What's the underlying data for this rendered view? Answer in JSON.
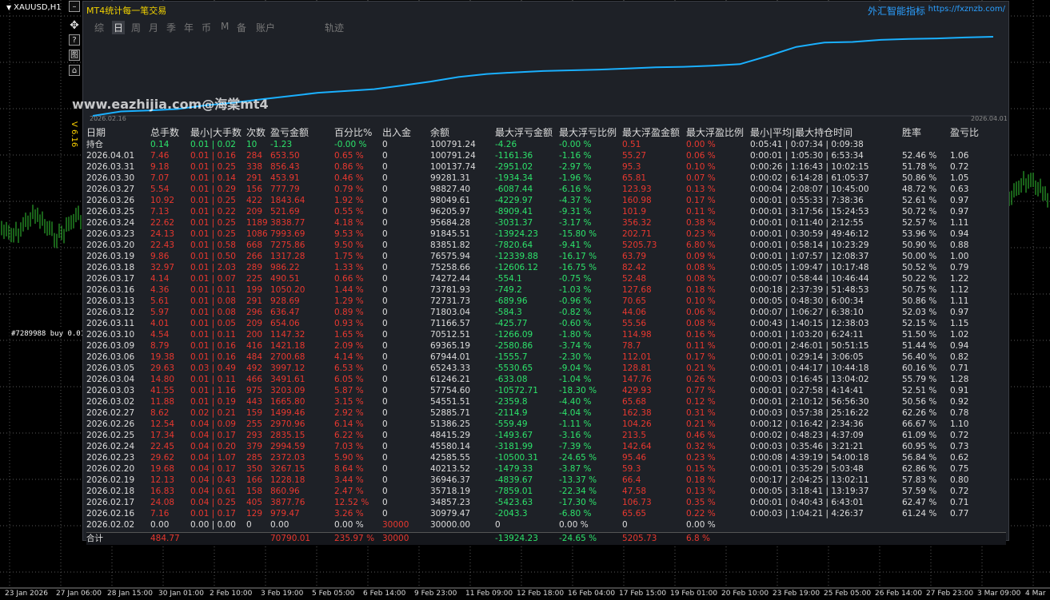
{
  "symbol": "XAUUSD,H1",
  "side_buttons": [
    "–",
    "✥",
    "?",
    "图",
    "⌂"
  ],
  "x_axis_labels": [
    "23 Jan 2026",
    "27 Jan 06:00",
    "28 Jan 15:00",
    "30 Jan 01:00",
    "2 Feb 10:00",
    "3 Feb 19:00",
    "5 Feb 05:00",
    "6 Feb 14:00",
    "9 Feb 23:00",
    "11 Feb 09:00",
    "12 Feb 18:00",
    "16 Feb 04:00",
    "17 Feb 15:00",
    "19 Feb 01:00",
    "20 Feb 10:00",
    "23 Feb 19:00",
    "25 Feb 05:00",
    "26 Feb 14:00",
    "27 Feb 23:00",
    "3 Mar 09:00",
    "4 Mar"
  ],
  "panel": {
    "title": "MT4统计每一笔交易",
    "brand": "外汇智能指标",
    "url": "https://fxznzb.com/",
    "tabs": [
      "综",
      "日",
      "周",
      "月",
      "季",
      "年",
      "币",
      "M",
      "备",
      "账户",
      "轨迹"
    ],
    "active_tab": "日",
    "watermark": "www.eazhijia.com@海棠mt4",
    "version": "V 6.16",
    "equity_start_label": "2026.02.16",
    "equity_end_label": "2026.04.01",
    "accent_color": "#1ab0ff",
    "equity_values": [
      30979.47,
      34857.23,
      35718.19,
      36946.37,
      40213.52,
      42585.55,
      45580.14,
      48415.29,
      51386.25,
      52885.71,
      54551.51,
      57754.6,
      61246.21,
      65243.33,
      67944.01,
      69365.19,
      70512.51,
      71166.57,
      71803.04,
      72731.73,
      73781.93,
      74272.44,
      75258.66,
      76575.94,
      83851.82,
      91845.51,
      95684.28,
      96205.97,
      98049.61,
      98827.4,
      99281.31,
      100137.74,
      100791.24
    ]
  },
  "headers": [
    "日期",
    "总手数",
    "最小|大手数",
    "次数",
    "盈亏金额",
    "百分比%",
    "出入金",
    "余额",
    "最大浮亏金额",
    "最大浮亏比例",
    "最大浮盈金额",
    "最大浮盈比例",
    "最小|平均|最大持仓时间",
    "胜率",
    "盈亏比"
  ],
  "holding": [
    "持仓",
    "0.14",
    "0.01 | 0.02",
    "10",
    "-1.23",
    "-0.00 %",
    "0",
    "100791.24",
    "-4.26",
    "-0.00 %",
    "0.51",
    "0.00 %",
    "0:05:41 | 0:07:34 | 0:09:38",
    "",
    ""
  ],
  "rows": [
    [
      "2026.04.01",
      "7.46",
      "0.01 | 0.16",
      "284",
      "653.50",
      "0.65 %",
      "0",
      "100791.24",
      "-1161.36",
      "-1.16 %",
      "55.27",
      "0.06 %",
      "0:00:01 | 1:05:30 | 6:53:34",
      "52.46 %",
      "1.06"
    ],
    [
      "2026.03.31",
      "9.18",
      "0.01 | 0.25",
      "338",
      "856.43",
      "0.86 %",
      "0",
      "100137.74",
      "-2951.02",
      "-2.97 %",
      "95.3",
      "0.10 %",
      "0:00:26 | 1:16:43 | 10:02:15",
      "51.78 %",
      "0.72"
    ],
    [
      "2026.03.30",
      "7.07",
      "0.01 | 0.14",
      "291",
      "453.91",
      "0.46 %",
      "0",
      "99281.31",
      "-1934.34",
      "-1.96 %",
      "65.81",
      "0.07 %",
      "0:00:02 | 6:14:28 | 61:05:37",
      "50.86 %",
      "1.05"
    ],
    [
      "2026.03.27",
      "5.54",
      "0.01 | 0.29",
      "156",
      "777.79",
      "0.79 %",
      "0",
      "98827.40",
      "-6087.44",
      "-6.16 %",
      "123.93",
      "0.13 %",
      "0:00:04 | 2:08:07 | 10:45:00",
      "48.72 %",
      "0.63"
    ],
    [
      "2026.03.26",
      "10.92",
      "0.01 | 0.25",
      "422",
      "1843.64",
      "1.92 %",
      "0",
      "98049.61",
      "-4229.97",
      "-4.37 %",
      "160.98",
      "0.17 %",
      "0:00:01 | 0:55:33 | 7:38:36",
      "52.61 %",
      "0.97"
    ],
    [
      "2026.03.25",
      "7.13",
      "0.01 | 0.22",
      "209",
      "521.69",
      "0.55 %",
      "0",
      "96205.97",
      "-8909.41",
      "-9.31 %",
      "101.9",
      "0.11 %",
      "0:00:01 | 3:17:56 | 15:24:53",
      "50.72 %",
      "0.97"
    ],
    [
      "2026.03.24",
      "22.62",
      "0.01 | 0.25",
      "1189",
      "3838.77",
      "4.18 %",
      "0",
      "95684.28",
      "-3031.37",
      "-3.17 %",
      "356.32",
      "0.38 %",
      "0:00:01 | 0:11:40 | 2:12:55",
      "52.57 %",
      "1.11"
    ],
    [
      "2026.03.23",
      "24.13",
      "0.01 | 0.25",
      "1086",
      "7993.69",
      "9.53 %",
      "0",
      "91845.51",
      "-13924.23",
      "-15.80 %",
      "202.71",
      "0.23 %",
      "0:00:01 | 0:30:59 | 49:46:12",
      "53.96 %",
      "0.94"
    ],
    [
      "2026.03.20",
      "22.43",
      "0.01 | 0.58",
      "668",
      "7275.86",
      "9.50 %",
      "0",
      "83851.82",
      "-7820.64",
      "-9.41 %",
      "5205.73",
      "6.80 %",
      "0:00:01 | 0:58:14 | 10:23:29",
      "50.90 %",
      "0.88"
    ],
    [
      "2026.03.19",
      "9.86",
      "0.01 | 0.50",
      "266",
      "1317.28",
      "1.75 %",
      "0",
      "76575.94",
      "-12339.88",
      "-16.17 %",
      "63.79",
      "0.09 %",
      "0:00:01 | 1:07:57 | 12:08:37",
      "50.00 %",
      "1.00"
    ],
    [
      "2026.03.18",
      "32.97",
      "0.01 | 2.03",
      "289",
      "986.22",
      "1.33 %",
      "0",
      "75258.66",
      "-12606.12",
      "-16.75 %",
      "82.42",
      "0.08 %",
      "0:00:05 | 1:09:47 | 10:17:48",
      "50.52 %",
      "0.79"
    ],
    [
      "2026.03.17",
      "4.14",
      "0.01 | 0.07",
      "225",
      "490.51",
      "0.66 %",
      "0",
      "74272.44",
      "-554.1",
      "-0.75 %",
      "52.48",
      "0.08 %",
      "0:00:07 | 0:58:44 | 10:46:44",
      "50.22 %",
      "1.22"
    ],
    [
      "2026.03.16",
      "4.36",
      "0.01 | 0.11",
      "199",
      "1050.20",
      "1.44 %",
      "0",
      "73781.93",
      "-749.2",
      "-1.03 %",
      "127.68",
      "0.18 %",
      "0:00:18 | 2:37:39 | 51:48:53",
      "50.75 %",
      "1.12"
    ],
    [
      "2026.03.13",
      "5.61",
      "0.01 | 0.08",
      "291",
      "928.69",
      "1.29 %",
      "0",
      "72731.73",
      "-689.96",
      "-0.96 %",
      "70.65",
      "0.10 %",
      "0:00:05 | 0:48:30 | 6:00:34",
      "50.86 %",
      "1.11"
    ],
    [
      "2026.03.12",
      "5.97",
      "0.01 | 0.08",
      "296",
      "636.47",
      "0.89 %",
      "0",
      "71803.04",
      "-584.3",
      "-0.82 %",
      "44.06",
      "0.06 %",
      "0:00:07 | 1:06:27 | 6:38:10",
      "52.03 %",
      "0.97"
    ],
    [
      "2026.03.11",
      "4.01",
      "0.01 | 0.05",
      "209",
      "654.06",
      "0.93 %",
      "0",
      "71166.57",
      "-425.77",
      "-0.60 %",
      "55.56",
      "0.08 %",
      "0:00:43 | 1:40:15 | 12:38:03",
      "52.15 %",
      "1.15"
    ],
    [
      "2026.03.10",
      "4.54",
      "0.01 | 0.11",
      "200",
      "1147.32",
      "1.65 %",
      "0",
      "70512.51",
      "-1266.09",
      "-1.80 %",
      "114.98",
      "0.16 %",
      "0:00:01 | 1:03:20 | 6:24:11",
      "51.50 %",
      "1.02"
    ],
    [
      "2026.03.09",
      "8.79",
      "0.01 | 0.16",
      "416",
      "1421.18",
      "2.09 %",
      "0",
      "69365.19",
      "-2580.86",
      "-3.74 %",
      "78.7",
      "0.11 %",
      "0:00:01 | 2:46:01 | 50:51:15",
      "51.44 %",
      "0.94"
    ],
    [
      "2026.03.06",
      "19.38",
      "0.01 | 0.16",
      "484",
      "2700.68",
      "4.14 %",
      "0",
      "67944.01",
      "-1555.7",
      "-2.30 %",
      "112.01",
      "0.17 %",
      "0:00:01 | 0:29:14 | 3:06:05",
      "56.40 %",
      "0.82"
    ],
    [
      "2026.03.05",
      "29.63",
      "0.03 | 0.49",
      "492",
      "3997.12",
      "6.53 %",
      "0",
      "65243.33",
      "-5530.65",
      "-9.04 %",
      "128.81",
      "0.21 %",
      "0:00:01 | 0:44:17 | 10:44:18",
      "60.16 %",
      "0.71"
    ],
    [
      "2026.03.04",
      "14.80",
      "0.01 | 0.11",
      "466",
      "3491.61",
      "6.05 %",
      "0",
      "61246.21",
      "-633.08",
      "-1.04 %",
      "147.76",
      "0.26 %",
      "0:00:03 | 0:16:45 | 13:04:02",
      "55.79 %",
      "1.28"
    ],
    [
      "2026.03.03",
      "41.55",
      "0.01 | 1.16",
      "975",
      "3203.09",
      "5.87 %",
      "0",
      "57754.60",
      "-10572.71",
      "-18.30 %",
      "429.93",
      "0.77 %",
      "0:00:01 | 0:27:58 | 4:14:41",
      "52.51 %",
      "0.91"
    ],
    [
      "2026.03.02",
      "11.88",
      "0.01 | 0.19",
      "443",
      "1665.80",
      "3.15 %",
      "0",
      "54551.51",
      "-2359.8",
      "-4.40 %",
      "65.68",
      "0.12 %",
      "0:00:01 | 2:10:12 | 56:56:30",
      "50.56 %",
      "0.92"
    ],
    [
      "2026.02.27",
      "8.62",
      "0.02 | 0.21",
      "159",
      "1499.46",
      "2.92 %",
      "0",
      "52885.71",
      "-2114.9",
      "-4.04 %",
      "162.38",
      "0.31 %",
      "0:00:03 | 0:57:38 | 25:16:22",
      "62.26 %",
      "0.78"
    ],
    [
      "2026.02.26",
      "12.54",
      "0.04 | 0.09",
      "255",
      "2970.96",
      "6.14 %",
      "0",
      "51386.25",
      "-559.49",
      "-1.11 %",
      "104.26",
      "0.21 %",
      "0:00:12 | 0:16:42 | 2:34:36",
      "66.67 %",
      "1.10"
    ],
    [
      "2026.02.25",
      "17.34",
      "0.04 | 0.17",
      "293",
      "2835.15",
      "6.22 %",
      "0",
      "48415.29",
      "-1493.67",
      "-3.16 %",
      "213.5",
      "0.46 %",
      "0:00:02 | 0:48:23 | 4:37:09",
      "61.09 %",
      "0.72"
    ],
    [
      "2026.02.24",
      "22.45",
      "0.04 | 0.20",
      "379",
      "2994.59",
      "7.03 %",
      "0",
      "45580.14",
      "-3181.99",
      "-7.39 %",
      "142.64",
      "0.32 %",
      "0:00:03 | 0:35:46 | 3:21:21",
      "60.95 %",
      "0.73"
    ],
    [
      "2026.02.23",
      "29.62",
      "0.04 | 1.07",
      "285",
      "2372.03",
      "5.90 %",
      "0",
      "42585.55",
      "-10500.31",
      "-24.65 %",
      "95.46",
      "0.23 %",
      "0:00:08 | 4:39:19 | 54:00:18",
      "56.84 %",
      "0.62"
    ],
    [
      "2026.02.20",
      "19.68",
      "0.04 | 0.17",
      "350",
      "3267.15",
      "8.64 %",
      "0",
      "40213.52",
      "-1479.33",
      "-3.87 %",
      "59.3",
      "0.15 %",
      "0:00:01 | 0:35:29 | 5:03:48",
      "62.86 %",
      "0.75"
    ],
    [
      "2026.02.19",
      "12.13",
      "0.04 | 0.43",
      "166",
      "1228.18",
      "3.44 %",
      "0",
      "36946.37",
      "-4839.67",
      "-13.37 %",
      "66.4",
      "0.18 %",
      "0:00:17 | 2:04:25 | 13:02:11",
      "57.83 %",
      "0.80"
    ],
    [
      "2026.02.18",
      "16.83",
      "0.04 | 0.61",
      "158",
      "860.96",
      "2.47 %",
      "0",
      "35718.19",
      "-7859.01",
      "-22.34 %",
      "47.58",
      "0.13 %",
      "0:00:05 | 3:18:41 | 13:19:37",
      "57.59 %",
      "0.72"
    ],
    [
      "2026.02.17",
      "24.08",
      "0.04 | 0.25",
      "405",
      "3877.76",
      "12.52 %",
      "0",
      "34857.23",
      "-5423.63",
      "-17.30 %",
      "106.73",
      "0.35 %",
      "0:00:01 | 0:40:43 | 6:43:01",
      "62.47 %",
      "0.71"
    ],
    [
      "2026.02.16",
      "7.16",
      "0.01 | 0.17",
      "129",
      "979.47",
      "3.26 %",
      "0",
      "30979.47",
      "-2043.3",
      "-6.80 %",
      "65.65",
      "0.22 %",
      "0:00:03 | 1:04:21 | 4:26:37",
      "61.24 %",
      "0.77"
    ]
  ],
  "deposit": [
    "2026.02.02",
    "0.00",
    "0.00 | 0.00",
    "0",
    "0.00",
    "0.00 %",
    "30000",
    "30000.00",
    "0",
    "0.00 %",
    "0",
    "0.00 %",
    "",
    "",
    ""
  ],
  "totals": [
    "合计",
    "484.77",
    "",
    "",
    "70790.01",
    "235.97 %",
    "30000",
    "",
    "-13924.23",
    "-24.65 %",
    "5205.73",
    "6.8 %",
    "",
    "",
    ""
  ]
}
